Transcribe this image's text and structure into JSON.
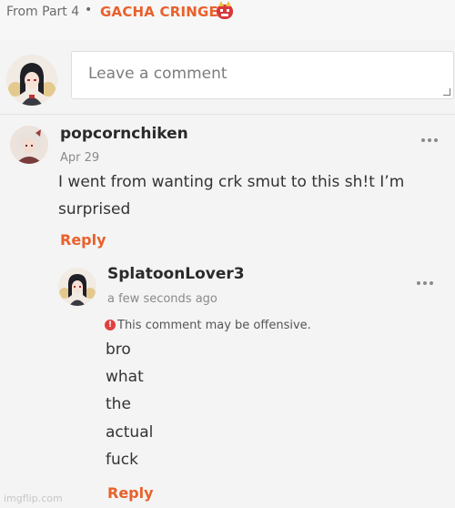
{
  "header": {
    "from_label": "From Part 4",
    "separator": "•",
    "part_title": "GACHA CRINGE",
    "emoji_icon": "ogre-mask-icon"
  },
  "comment_input": {
    "placeholder": "Leave a comment"
  },
  "comments": [
    {
      "username": "popcornchiken",
      "timestamp": "Apr 29",
      "text_lines": [
        "I went from wanting crk smut to this sh!t I’m",
        "surprised"
      ],
      "reply_label": "Reply",
      "replies": [
        {
          "username": "SplatoonLover3",
          "timestamp": "a few seconds ago",
          "warning": "This comment may be offensive.",
          "warning_icon": "alert-icon",
          "text_lines": [
            "bro",
            "what",
            "the",
            "actual",
            "fuck"
          ],
          "reply_label": "Reply"
        }
      ]
    }
  ],
  "watermark": "imgflip.com",
  "colors": {
    "accent": "#e8612c",
    "warning": "#e0413d",
    "background": "#f4f4f4"
  }
}
